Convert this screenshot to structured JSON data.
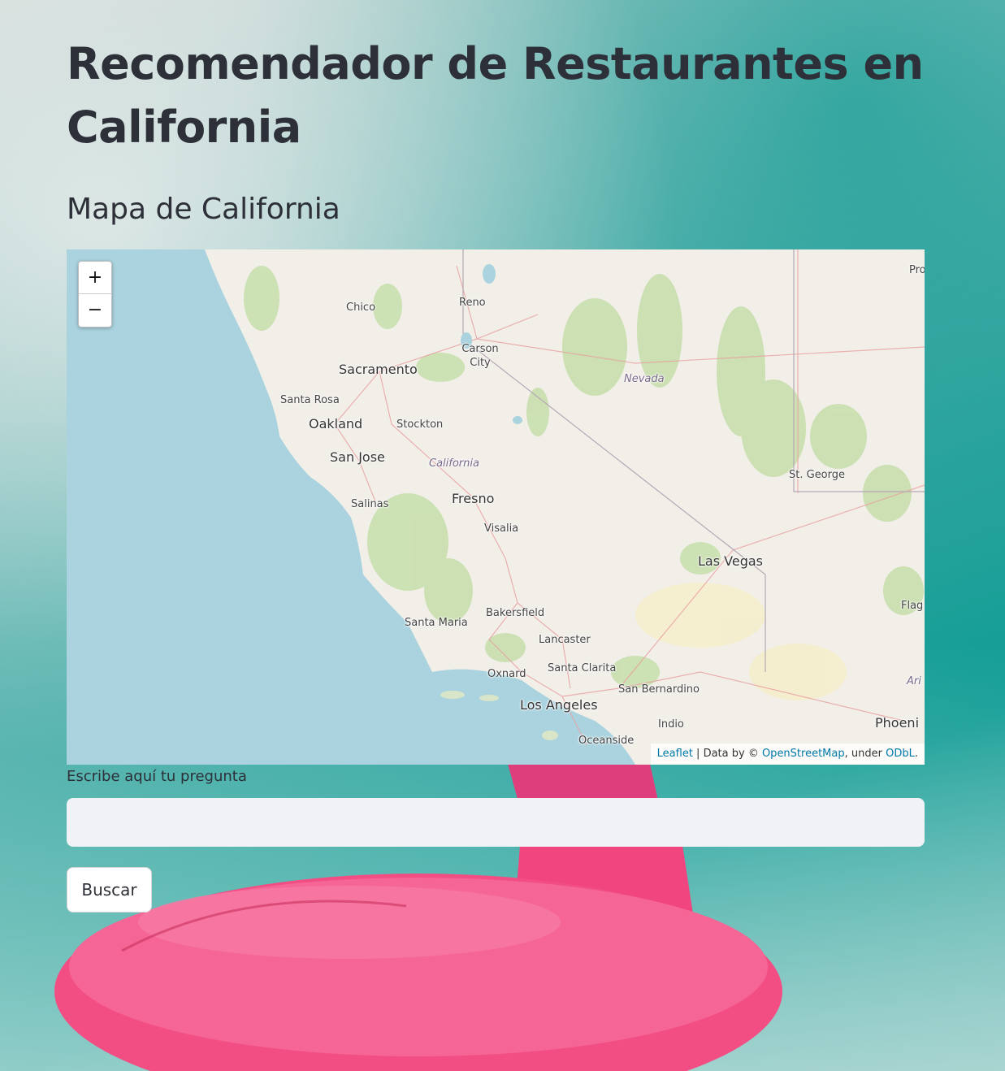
{
  "page": {
    "title": "Recomendador de Restaurantes en California",
    "subtitle": "Mapa de California"
  },
  "map": {
    "zoom_in": "+",
    "zoom_out": "−",
    "labels": {
      "chico": "Chico",
      "reno": "Reno",
      "carson_city": "Carson City",
      "sacramento": "Sacramento",
      "nevada": "Nevada",
      "santa_rosa": "Santa Rosa",
      "oakland": "Oakland",
      "stockton": "Stockton",
      "san_jose": "San Jose",
      "california": "California",
      "st_george": "St. George",
      "fresno": "Fresno",
      "salinas": "Salinas",
      "visalia": "Visalia",
      "las_vegas": "Las Vegas",
      "bakersfield": "Bakersfield",
      "santa_maria": "Santa Maria",
      "lancaster": "Lancaster",
      "flag": "Flag",
      "santa_clarita": "Santa Clarita",
      "oxnard": "Oxnard",
      "san_bernardino": "San Bernardino",
      "ari": "Ari",
      "los_angeles": "Los Angeles",
      "indio": "Indio",
      "phoenix": "Phoeni",
      "oceanside": "Oceanside",
      "pro": "Pro"
    },
    "attribution": {
      "leaflet": "Leaflet",
      "sep": " | Data by © ",
      "osm": "OpenStreetMap",
      "under": ", under ",
      "odbl": "ODbL",
      "end": "."
    },
    "colors": {
      "water": "#aad3df",
      "land": "#f2efe9",
      "park": "#c8dfae",
      "road": "#e8a0a0"
    }
  },
  "question": {
    "label": "Escribe aquí tu pregunta",
    "value": "",
    "placeholder": ""
  },
  "search_button": {
    "label": "Buscar"
  }
}
